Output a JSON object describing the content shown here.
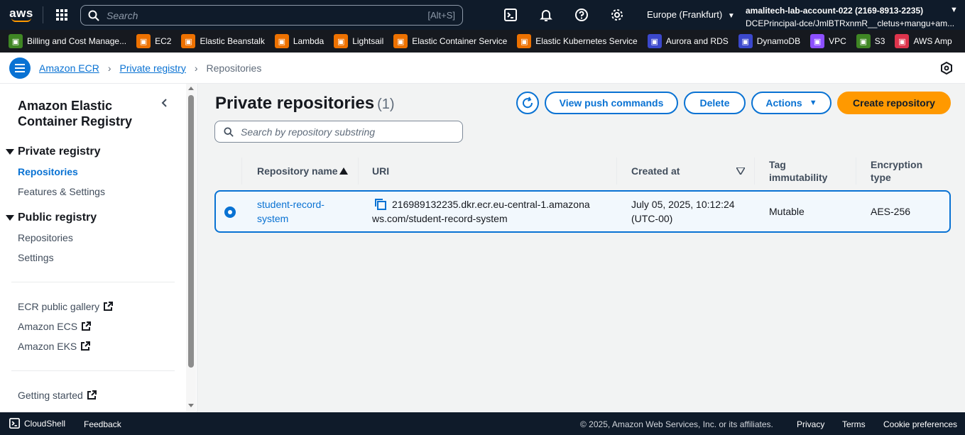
{
  "topnav": {
    "logo_text": "aws",
    "search_placeholder": "Search",
    "search_shortcut": "[Alt+S]",
    "region": "Europe (Frankfurt)",
    "account_name": "amalitech-lab-account-022 (2169-8913-2235)",
    "account_role": "DCEPrincipal-dce/JmlBTRxnmR__cletus+mangu+am..."
  },
  "favorites": [
    {
      "label": "Billing and Cost Manage...",
      "color": "#3f8624",
      "icon": "billing-icon"
    },
    {
      "label": "EC2",
      "color": "#ed7100",
      "icon": "ec2-icon"
    },
    {
      "label": "Elastic Beanstalk",
      "color": "#ed7100",
      "icon": "beanstalk-icon"
    },
    {
      "label": "Lambda",
      "color": "#ed7100",
      "icon": "lambda-icon"
    },
    {
      "label": "Lightsail",
      "color": "#ed7100",
      "icon": "lightsail-icon"
    },
    {
      "label": "Elastic Container Service",
      "color": "#ed7100",
      "icon": "ecs-icon"
    },
    {
      "label": "Elastic Kubernetes Service",
      "color": "#ed7100",
      "icon": "eks-icon"
    },
    {
      "label": "Aurora and RDS",
      "color": "#3b48cc",
      "icon": "rds-icon"
    },
    {
      "label": "DynamoDB",
      "color": "#3b48cc",
      "icon": "dynamodb-icon"
    },
    {
      "label": "VPC",
      "color": "#8c4fff",
      "icon": "vpc-icon"
    },
    {
      "label": "S3",
      "color": "#3f8624",
      "icon": "s3-icon"
    },
    {
      "label": "AWS Amp",
      "color": "#dd344c",
      "icon": "amplify-icon"
    }
  ],
  "breadcrumb": {
    "items": [
      "Amazon ECR",
      "Private registry",
      "Repositories"
    ]
  },
  "sidenav": {
    "title": "Amazon Elastic Container Registry",
    "private_section": "Private registry",
    "private_links": [
      "Repositories",
      "Features & Settings"
    ],
    "public_section": "Public registry",
    "public_links": [
      "Repositories",
      "Settings"
    ],
    "external_links": [
      "ECR public gallery",
      "Amazon ECS",
      "Amazon EKS"
    ],
    "getting_started": "Getting started"
  },
  "main": {
    "title": "Private repositories",
    "count": "(1)",
    "buttons": {
      "view_push": "View push commands",
      "delete": "Delete",
      "actions": "Actions",
      "create": "Create repository"
    },
    "search_placeholder": "Search by repository substring",
    "columns": {
      "name": "Repository name",
      "uri": "URI",
      "created": "Created at",
      "tag": "Tag immutability",
      "encryption": "Encryption type"
    },
    "rows": [
      {
        "name_line1": "student-record-",
        "name_line2": "system",
        "uri_line1": "216989132235.dkr.ecr.eu-central-1.amazona",
        "uri_line2": "ws.com/student-record-system",
        "created_line1": "July 05, 2025, 10:12:24",
        "created_line2": "(UTC-00)",
        "tag": "Mutable",
        "encryption": "AES-256"
      }
    ]
  },
  "footer": {
    "cloudshell": "CloudShell",
    "feedback": "Feedback",
    "copyright": "© 2025, Amazon Web Services, Inc. or its affiliates.",
    "privacy": "Privacy",
    "terms": "Terms",
    "cookies": "Cookie preferences"
  }
}
